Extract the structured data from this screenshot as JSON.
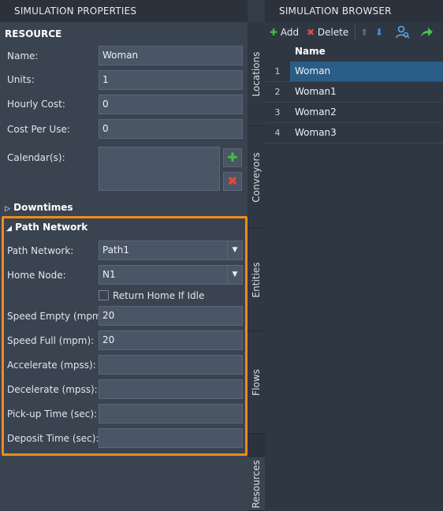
{
  "left_panel": {
    "title": "SIMULATION PROPERTIES",
    "resource_heading": "RESOURCE",
    "fields": {
      "name": {
        "label": "Name:",
        "value": "Woman"
      },
      "units": {
        "label": "Units:",
        "value": "1"
      },
      "hourly_cost": {
        "label": "Hourly Cost:",
        "value": "0"
      },
      "cost_per_use": {
        "label": "Cost Per Use:",
        "value": "0"
      },
      "calendars": {
        "label": "Calendar(s):",
        "value": ""
      }
    },
    "downtimes_heading": "Downtimes",
    "path_network_section": {
      "heading": "Path Network",
      "path_network": {
        "label": "Path Network:",
        "value": "Path1"
      },
      "home_node": {
        "label": "Home Node:",
        "value": "N1"
      },
      "return_home": {
        "label": "Return Home If Idle",
        "checked": false
      },
      "speed_empty": {
        "label": "Speed Empty (mpm):",
        "value": "20"
      },
      "speed_full": {
        "label": "Speed Full (mpm):",
        "value": "20"
      },
      "accelerate": {
        "label": "Accelerate (mpss):",
        "value": ""
      },
      "decelerate": {
        "label": "Decelerate (mpss):",
        "value": ""
      },
      "pickup_time": {
        "label": "Pick-up Time (sec):",
        "value": ""
      },
      "deposit_time": {
        "label": "Deposit Time (sec):",
        "value": ""
      }
    }
  },
  "vertical_tabs": [
    "Locations",
    "Conveyors",
    "Entities",
    "Flows",
    "Resources"
  ],
  "right_panel": {
    "title": "SIMULATION BROWSER",
    "toolbar": {
      "add_label": "Add",
      "delete_label": "Delete"
    },
    "column_header": "Name",
    "rows": [
      {
        "num": "1",
        "name": "Woman",
        "selected": true
      },
      {
        "num": "2",
        "name": "Woman1",
        "selected": false
      },
      {
        "num": "3",
        "name": "Woman2",
        "selected": false
      },
      {
        "num": "4",
        "name": "Woman3",
        "selected": false
      }
    ]
  },
  "colors": {
    "highlight": "#f08a1c",
    "add_green": "#3fbf3f",
    "delete_red": "#e24a3b",
    "arrow_blue": "#3f8fe0"
  }
}
